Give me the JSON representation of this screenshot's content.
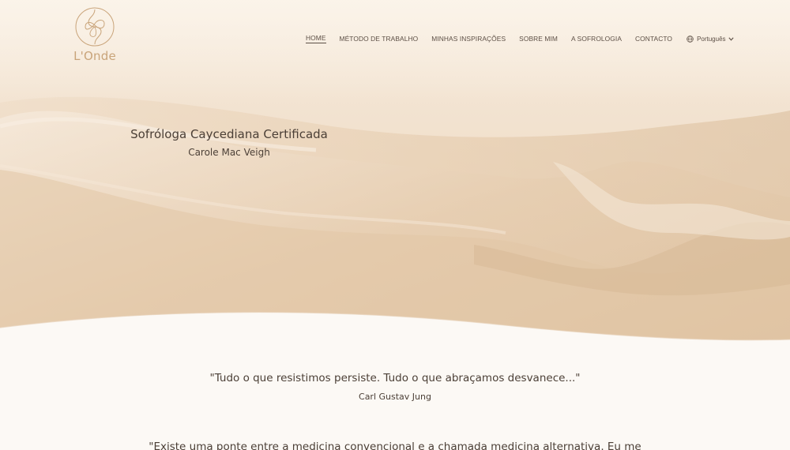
{
  "brand": {
    "logo_text": "L'Onde"
  },
  "nav": {
    "items": [
      {
        "label": "HOME",
        "active": true
      },
      {
        "label": "MÉTODO DE TRABALHO",
        "active": false
      },
      {
        "label": "MINHAS INSPIRAÇÕES",
        "active": false
      },
      {
        "label": "SOBRE MIM",
        "active": false
      },
      {
        "label": "A SOFROLOGIA",
        "active": false
      },
      {
        "label": "CONTACTO",
        "active": false
      }
    ],
    "language": {
      "label": "Português",
      "icon": "globe-icon"
    }
  },
  "hero": {
    "title": "Sofróloga Caycediana Certificada",
    "subtitle": "Carole Mac Veigh"
  },
  "quote": {
    "text": "\"Tudo o que resistimos persiste. Tudo o que abraçamos desvanece...\"",
    "author": "Carl Gustav Jung"
  },
  "intro": {
    "text": "\"Existe uma ponte entre a medicina convencional e a chamada medicina alternativa. Eu me"
  },
  "colors": {
    "accent_gold": "#c9a47a",
    "text_dark": "#4b3f36",
    "background": "#fcf9f5",
    "hero_sand": "#ecd6bd"
  }
}
